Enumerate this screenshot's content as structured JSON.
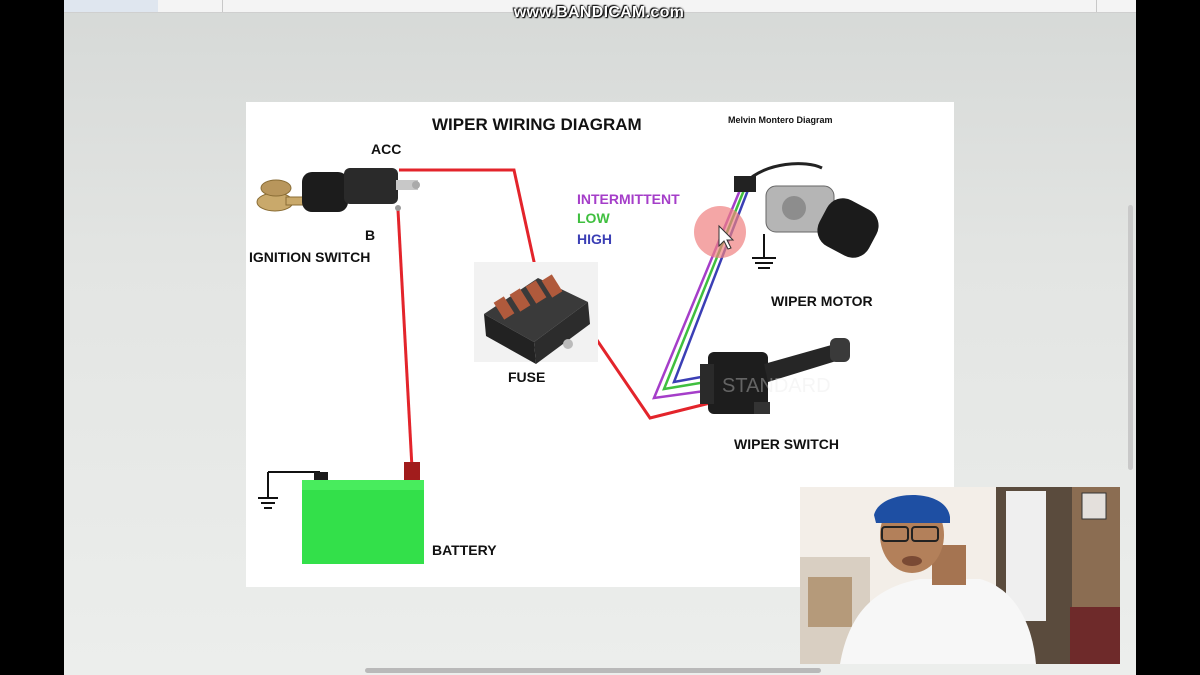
{
  "recorder": {
    "watermark": "www.BANDICAM.com"
  },
  "diagram": {
    "title": "WIPER WIRING DIAGRAM",
    "author": "Melvin Montero Diagram",
    "labels": {
      "acc": "ACC",
      "b": "B",
      "ignition_switch": "IGNITION SWITCH",
      "fuse": "FUSE",
      "battery": "BATTERY",
      "wiper_motor": "WIPER MOTOR",
      "wiper_switch": "WIPER SWITCH"
    },
    "legend": [
      {
        "label": "INTERMITTENT",
        "color": "#a53ec9"
      },
      {
        "label": "LOW",
        "color": "#3fbf3f"
      },
      {
        "label": "HIGH",
        "color": "#3b3fb5"
      }
    ],
    "colors": {
      "power_wire": "#e3242b",
      "battery": "#33e04a",
      "cursor_highlight": "#f08080"
    }
  }
}
